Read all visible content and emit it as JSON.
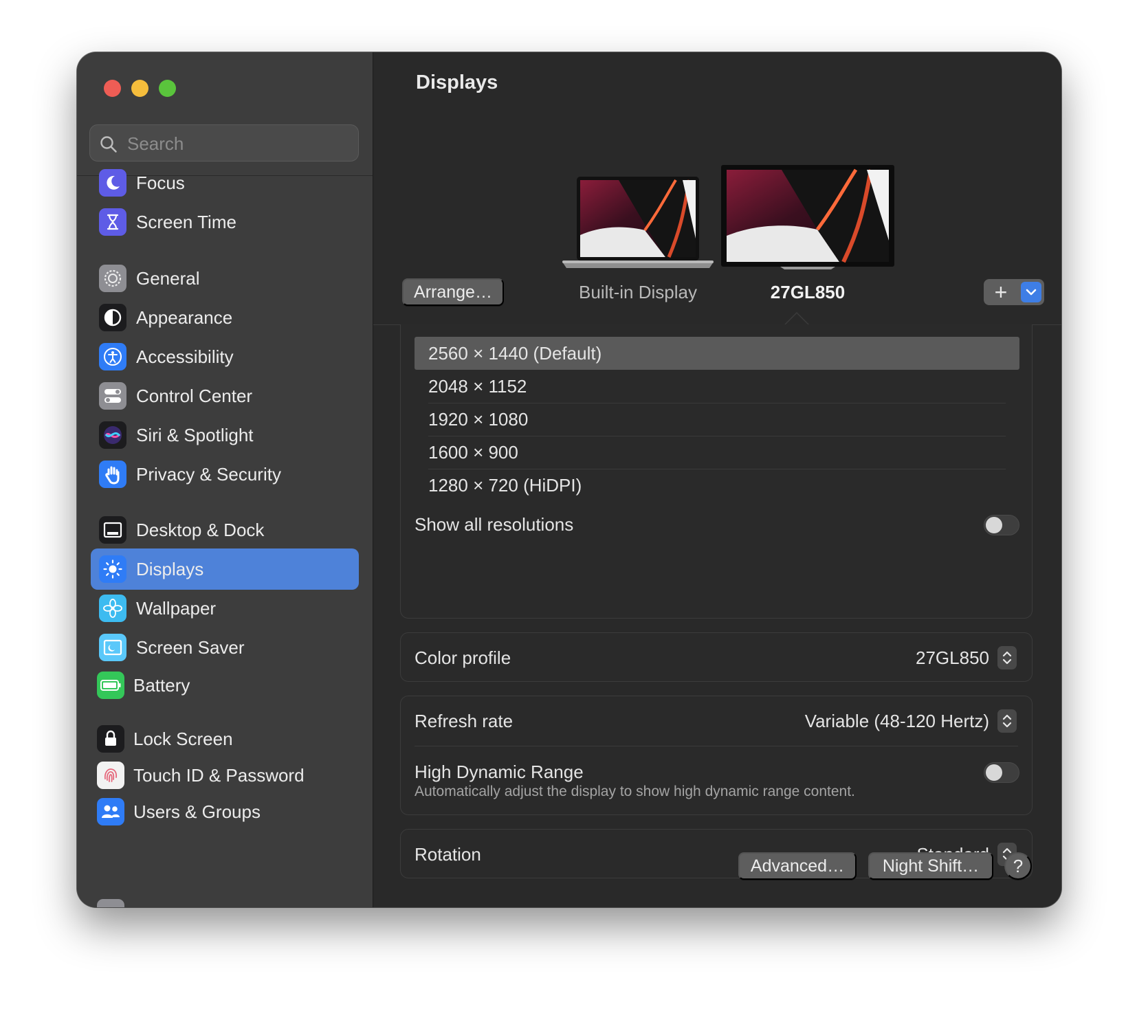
{
  "window": {
    "title": "Displays"
  },
  "search": {
    "placeholder": "Search"
  },
  "sidebar": {
    "items": [
      {
        "label": "Focus",
        "icon": "moon-icon",
        "color": "#5e5ce6"
      },
      {
        "label": "Screen Time",
        "icon": "hourglass-icon",
        "color": "#5e5ce6"
      },
      {
        "label": "General",
        "icon": "gear-icon",
        "color": "#8e8e93"
      },
      {
        "label": "Appearance",
        "icon": "appearance-icon",
        "color": "#1c1c1e"
      },
      {
        "label": "Accessibility",
        "icon": "accessibility-icon",
        "color": "#2f7cf6"
      },
      {
        "label": "Control Center",
        "icon": "toggles-icon",
        "color": "#8e8e93"
      },
      {
        "label": "Siri & Spotlight",
        "icon": "siri-icon",
        "color": "#1c1c1e"
      },
      {
        "label": "Privacy & Security",
        "icon": "hand-icon",
        "color": "#2f7cf6"
      },
      {
        "label": "Desktop & Dock",
        "icon": "dock-icon",
        "color": "#1c1c1e"
      },
      {
        "label": "Displays",
        "icon": "sun-icon",
        "color": "#2f7cf6",
        "active": true
      },
      {
        "label": "Wallpaper",
        "icon": "flower-icon",
        "color": "#3dbbf0"
      },
      {
        "label": "Screen Saver",
        "icon": "screen-saver-icon",
        "color": "#5ac8fa"
      },
      {
        "label": "Battery",
        "icon": "battery-icon",
        "color": "#34c759"
      },
      {
        "label": "Lock Screen",
        "icon": "lock-icon",
        "color": "#1c1c1e"
      },
      {
        "label": "Touch ID & Password",
        "icon": "fingerprint-icon",
        "color": "#f2f2f2"
      },
      {
        "label": "Users & Groups",
        "icon": "users-icon",
        "color": "#2f7cf6"
      }
    ]
  },
  "header": {
    "arrange_label": "Arrange…",
    "add_label": "+",
    "displays": [
      {
        "label": "Built-in Display",
        "selected": false
      },
      {
        "label": "27GL850",
        "selected": true
      }
    ]
  },
  "resolutions": {
    "options": [
      "2560 × 1440 (Default)",
      "2048 × 1152",
      "1920 × 1080",
      "1600 × 900",
      "1280 × 720 (HiDPI)"
    ],
    "selected_index": 0,
    "show_all_label": "Show all resolutions",
    "show_all_enabled": false
  },
  "color_profile": {
    "label": "Color profile",
    "value": "27GL850"
  },
  "refresh": {
    "label": "Refresh rate",
    "value": "Variable (48-120 Hertz)"
  },
  "hdr": {
    "label": "High Dynamic Range",
    "description": "Automatically adjust the display to show high dynamic range content.",
    "enabled": false
  },
  "rotation": {
    "label": "Rotation",
    "value": "Standard"
  },
  "footer": {
    "advanced_label": "Advanced…",
    "night_shift_label": "Night Shift…",
    "help_label": "?"
  },
  "colors": {
    "accent": "#4e82d9",
    "sidebar_bg": "#3d3d3d",
    "content_bg": "#292929"
  }
}
